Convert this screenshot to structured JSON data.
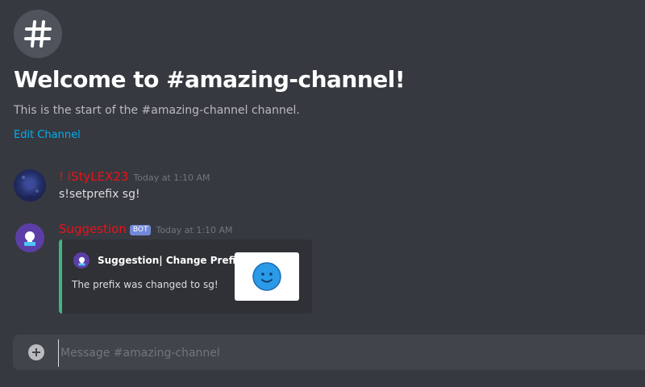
{
  "colors": {
    "background": "#36393f",
    "accent_link": "#00b0f4",
    "username_red": "#e8131b",
    "embed_bar": "#43b581",
    "bot_tag": "#7289da"
  },
  "hero": {
    "icon": "hash-icon",
    "title": "Welcome to #amazing-channel!",
    "subtitle": "This is the start of the #amazing-channel channel.",
    "edit_link": "Edit Channel"
  },
  "messages": [
    {
      "author": "! iStyLEX23",
      "timestamp": "Today at 1:10 AM",
      "content": "s!setprefix sg!"
    },
    {
      "author": "Suggestion",
      "bot_tag": "BOT",
      "timestamp": "Today at 1:10 AM",
      "embed": {
        "author_icon": "lightbulb-icon",
        "author_name": "Suggestion| Change Prefix",
        "description": "The prefix was changed to sg!",
        "thumbnail": "smiley-face-icon"
      }
    }
  ],
  "composer": {
    "add_icon": "plus-circle-icon",
    "placeholder": "Message #amazing-channel"
  }
}
